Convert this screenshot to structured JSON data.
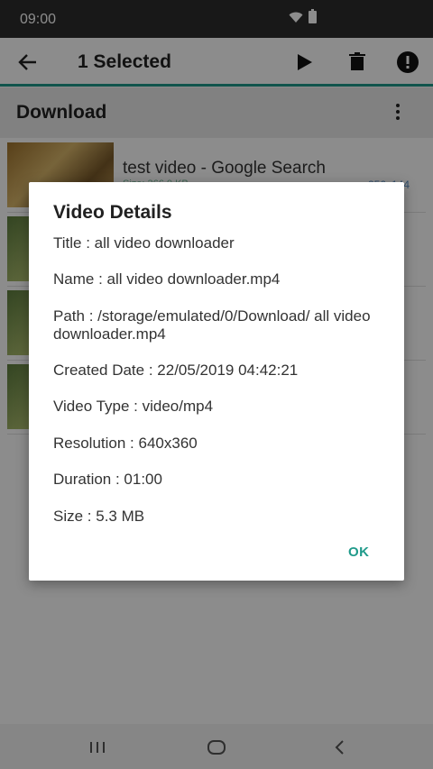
{
  "status": {
    "time": "09:00"
  },
  "toolbar": {
    "title": "1 Selected"
  },
  "subbar": {
    "label": "Download"
  },
  "list": [
    {
      "title": "test video - Google Search",
      "sub": "Size: 366.0 KB",
      "res": "256x144"
    },
    {
      "title": "",
      "sub": "",
      "res": ""
    },
    {
      "title": "",
      "sub": "",
      "res": ""
    },
    {
      "title": "",
      "sub": "",
      "res": ""
    }
  ],
  "dialog": {
    "title": "Video Details",
    "fields": {
      "title": "Title : all video downloader",
      "name": "Name : all video downloader.mp4",
      "path": "Path : /storage/emulated/0/Download/ all video downloader.mp4",
      "created": "Created Date : 22/05/2019 04:42:21",
      "type": "Video Type : video/mp4",
      "resolution": "Resolution : 640x360",
      "duration": "Duration : 01:00",
      "size": "Size : 5.3 MB"
    },
    "ok_label": "OK"
  },
  "colors": {
    "accent": "#1f9a8a",
    "statusbar": "#2d2d2d"
  }
}
